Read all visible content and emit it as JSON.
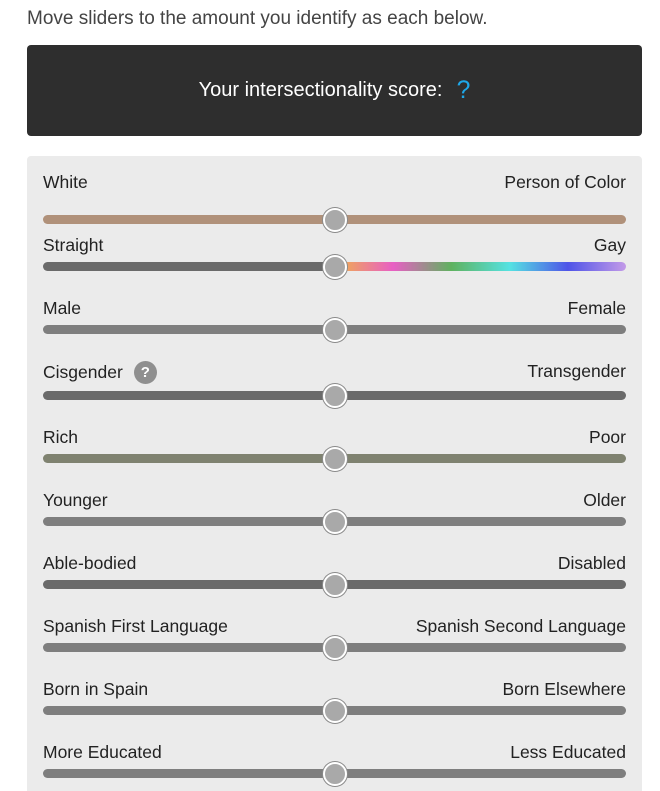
{
  "instructions": "Move sliders to the amount you identify as each below.",
  "score": {
    "label": "Your intersectionality score:",
    "value": "?"
  },
  "colors": {
    "score_bg": "#2e2e2e",
    "score_value": "#1ea7e8",
    "panel_bg": "#ebebeb",
    "thumb": "#a9a9a9",
    "race_track": "#b0917a",
    "class_track": "#7f8270",
    "dark_track": "#6a6a6a",
    "default_track": "#7e7e7e"
  },
  "sliders": [
    {
      "left": "White",
      "right": "Person of Color",
      "value": 0.5,
      "track": "race"
    },
    {
      "left": "Straight",
      "right": "Gay",
      "value": 0.5,
      "track": "rainbow"
    },
    {
      "left": "Male",
      "right": "Female",
      "value": 0.5,
      "track": "default"
    },
    {
      "left": "Cisgender",
      "right": "Transgender",
      "value": 0.5,
      "track": "dark",
      "help_icon": "question-icon",
      "help_text": "?"
    },
    {
      "left": "Rich",
      "right": "Poor",
      "value": 0.5,
      "track": "class"
    },
    {
      "left": "Younger",
      "right": "Older",
      "value": 0.5,
      "track": "default"
    },
    {
      "left": "Able-bodied",
      "right": "Disabled",
      "value": 0.5,
      "track": "dark"
    },
    {
      "left": "Spanish First Language",
      "right": "Spanish Second Language",
      "value": 0.5,
      "track": "default"
    },
    {
      "left": "Born in Spain",
      "right": "Born Elsewhere",
      "value": 0.5,
      "track": "default"
    },
    {
      "left": "More Educated",
      "right": "Less Educated",
      "value": 0.5,
      "track": "default"
    }
  ]
}
